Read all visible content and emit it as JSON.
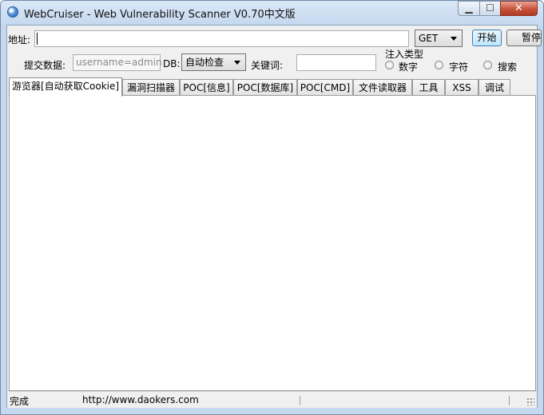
{
  "window": {
    "title": "WebCruiser - Web Vulnerability Scanner V0.70中文版"
  },
  "toolbar": {
    "address_label": "地址:",
    "address_value": "",
    "method": "GET",
    "start_label": "开始",
    "pause_label": "暂停"
  },
  "options": {
    "submit_label": "提交数据:",
    "submit_placeholder": "username=admin",
    "db_label": "DB:",
    "db_value": "自动检查",
    "keyword_label": "关键词:",
    "keyword_value": "",
    "injection": {
      "title": "注入类型",
      "types": [
        "数字",
        "字符",
        "搜索"
      ]
    }
  },
  "tabs": [
    "游览器[自动获取Cookie]",
    "漏洞扫描器",
    "POC[信息]",
    "POC[数据库]",
    "POC[CMD]",
    "文件读取器",
    "工具",
    "XSS",
    "调试"
  ],
  "active_tab": 0,
  "status": {
    "state": "完成",
    "url": "http://www.daokers.com"
  },
  "icons": {
    "app": "globe-icon",
    "minimize": "minimize-icon",
    "maximize": "maximize-icon",
    "close": "close-icon",
    "dropdown": "chevron-down-icon",
    "resize": "resize-grip-icon"
  }
}
